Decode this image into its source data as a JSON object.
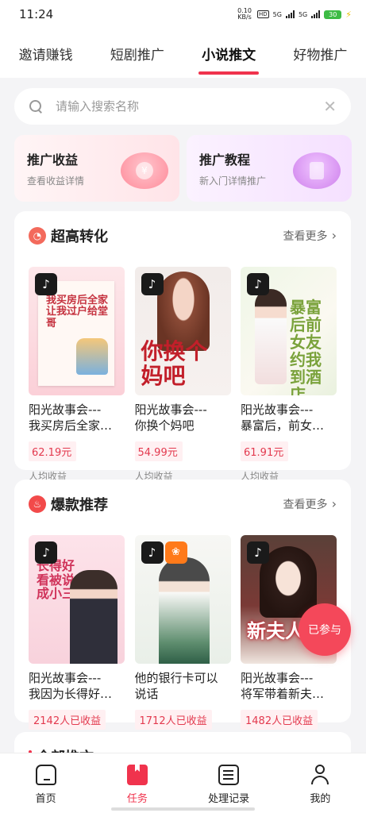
{
  "status": {
    "time": "11:24",
    "net_speed": "0.10 KB/s",
    "hd": "HD",
    "sig1": "5G",
    "sig2": "5G",
    "battery": "30"
  },
  "tabs": [
    "邀请赚钱",
    "短剧推广",
    "小说推文",
    "好物推广"
  ],
  "search": {
    "placeholder": "请输入搜索名称"
  },
  "promo": [
    {
      "title": "推广收益",
      "subtitle": "查看收益详情",
      "icon": "yen-coin-icon"
    },
    {
      "title": "推广教程",
      "subtitle": "新入门详情推广",
      "icon": "book-icon"
    }
  ],
  "section_high": {
    "title": "超高转化",
    "more": "查看更多",
    "books": [
      {
        "cover_text": "我买房后全家让我过户给堂哥",
        "line1": "阳光故事会---",
        "line2": "我买房后全家…",
        "price": "62.19元",
        "price_label": "人均收益"
      },
      {
        "cover_text": "你换个妈吧",
        "line1": "阳光故事会---",
        "line2": "你换个妈吧",
        "price": "54.99元",
        "price_label": "人均收益"
      },
      {
        "cover_text": "暴富后前女友约我到酒店",
        "line1": "阳光故事会---",
        "line2": "暴富后，前女…",
        "price": "61.91元",
        "price_label": "人均收益"
      }
    ]
  },
  "section_hot": {
    "title": "爆款推荐",
    "more": "查看更多",
    "books": [
      {
        "cover_text": "长得好看被说成小三",
        "line1": "阳光故事会---",
        "line2": "我因为长得好…",
        "earners": "2142人已收益"
      },
      {
        "cover_text": "",
        "line1": "他的银行卡可以",
        "line2": "说话",
        "earners": "1712人已收益"
      },
      {
        "cover_text": "新夫人",
        "line1": "阳光故事会---",
        "line2": "将军带着新夫…",
        "earners": "1482人已收益"
      }
    ]
  },
  "section_all": {
    "title": "全部推文"
  },
  "joined_button": "已参与",
  "nav": [
    {
      "label": "首页",
      "icon": "home-icon"
    },
    {
      "label": "任务",
      "icon": "task-icon"
    },
    {
      "label": "处理记录",
      "icon": "record-list-icon"
    },
    {
      "label": "我的",
      "icon": "profile-icon"
    }
  ],
  "colors": {
    "accent": "#f0334d",
    "price_text": "#e33a4f",
    "price_bg": "#fff0f2"
  }
}
